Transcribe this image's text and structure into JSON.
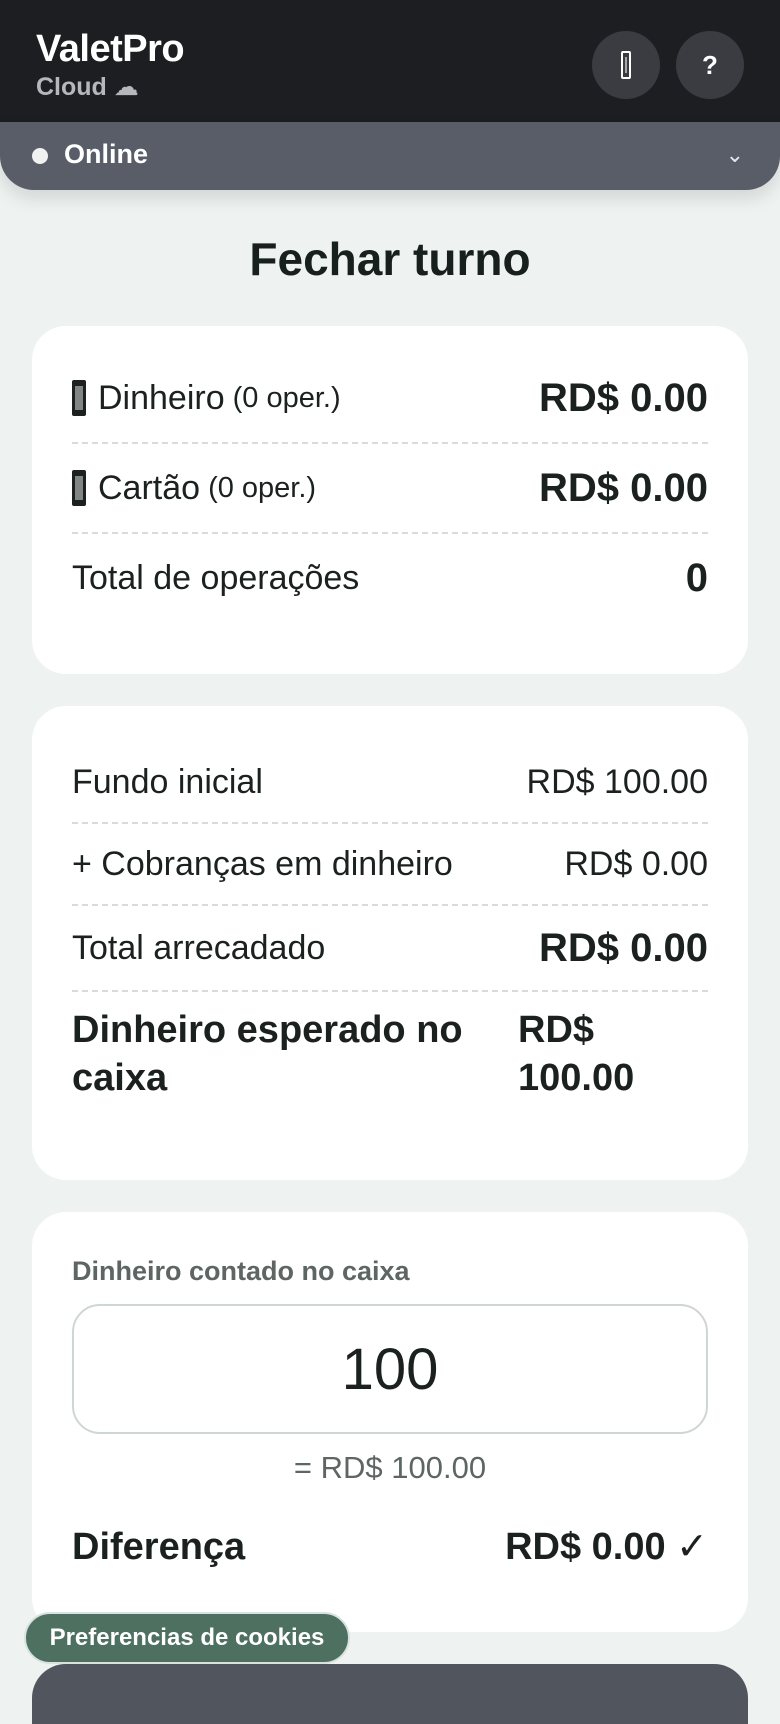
{
  "app": {
    "name": "ValetPro",
    "subtitle": "Cloud ☁"
  },
  "header": {
    "help_label": "?"
  },
  "status": {
    "label": "Online",
    "chevron": "⌄"
  },
  "page": {
    "title": "Fechar turno"
  },
  "summary": {
    "cash": {
      "label": "Dinheiro",
      "ops": "(0 oper.)",
      "value": "RD$ 0.00"
    },
    "card": {
      "label": "Cartão",
      "ops": "(0 oper.)",
      "value": "RD$ 0.00"
    },
    "total_ops": {
      "label": "Total de operações",
      "value": "0"
    }
  },
  "cashbox": {
    "initial": {
      "label": "Fundo inicial",
      "value": "RD$ 100.00"
    },
    "cash_charges": {
      "label": "+ Cobranças em dinheiro",
      "value": "RD$ 0.00"
    },
    "total": {
      "label": "Total arrecadado",
      "value": "RD$ 0.00"
    },
    "expected": {
      "label": "Dinheiro esperado no caixa",
      "value": "RD$ 100.00"
    }
  },
  "count": {
    "label": "Dinheiro contado no caixa",
    "input_value": "100",
    "echo": "= RD$ 100.00",
    "diff_label": "Diferença",
    "diff_value": "RD$ 0.00 ✓"
  },
  "cookies": {
    "label": "Preferencias de cookies"
  },
  "colors": {
    "topbar": "#1c1e22",
    "statusbar": "#585d67",
    "cookie_button": "#4e7061"
  }
}
